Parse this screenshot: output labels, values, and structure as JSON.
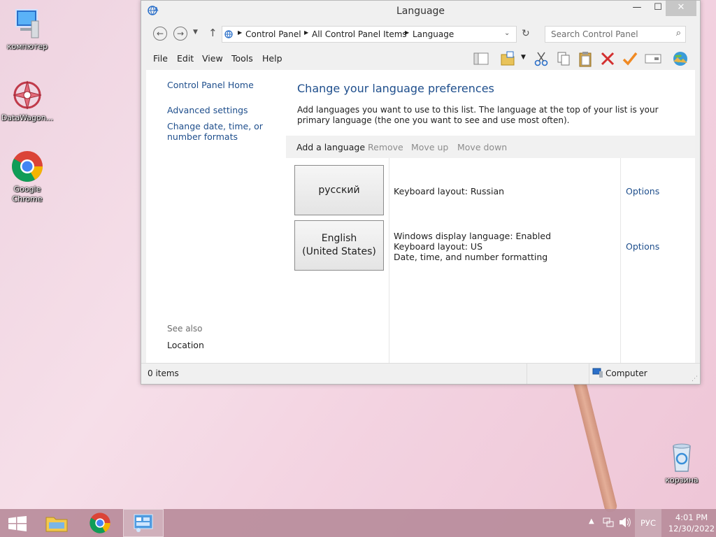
{
  "desktop": {
    "icons": [
      {
        "label": "компютер",
        "icon": "computer-icon"
      },
      {
        "label": "DataWagon...",
        "icon": "datawagon-icon"
      },
      {
        "label": "Google Chrome",
        "icon": "chrome-icon"
      },
      {
        "label": "корзина",
        "icon": "recycle-bin-icon"
      }
    ]
  },
  "window": {
    "title": "Language",
    "controls": {
      "minimize": "—",
      "maximize": "☐",
      "close": "✕"
    },
    "address": {
      "crumbs": [
        "Control Panel",
        "All Control Panel Items",
        "Language"
      ],
      "search_placeholder": "Search Control Panel"
    },
    "menu": [
      "File",
      "Edit",
      "View",
      "Tools",
      "Help"
    ],
    "left_pane": {
      "home": "Control Panel Home",
      "links": [
        "Advanced settings",
        "Change date, time, or number formats"
      ],
      "see_also_heading": "See also",
      "see_also": [
        "Location"
      ]
    },
    "main": {
      "heading": "Change your language preferences",
      "description": "Add languages you want to use to this list. The language at the top of your list is your primary language (the one you want to see and use most often).",
      "toolbar": [
        "Add a language",
        "Remove",
        "Move up",
        "Move down"
      ],
      "languages": [
        {
          "name": "русский",
          "details": [
            "Keyboard layout: Russian"
          ],
          "options": "Options"
        },
        {
          "name": "English (United States)",
          "details": [
            "Windows display language: Enabled",
            "Keyboard layout: US",
            "Date, time, and number formatting"
          ],
          "options": "Options"
        }
      ]
    },
    "status": {
      "items": "0 items",
      "location": "Computer"
    }
  },
  "taskbar": {
    "clock_time": "4:01 PM",
    "clock_date": "12/30/2022",
    "input_lang": "РУС",
    "colors": {
      "accent": "#1e4e8c",
      "taskbar": "#b88c9b"
    }
  }
}
